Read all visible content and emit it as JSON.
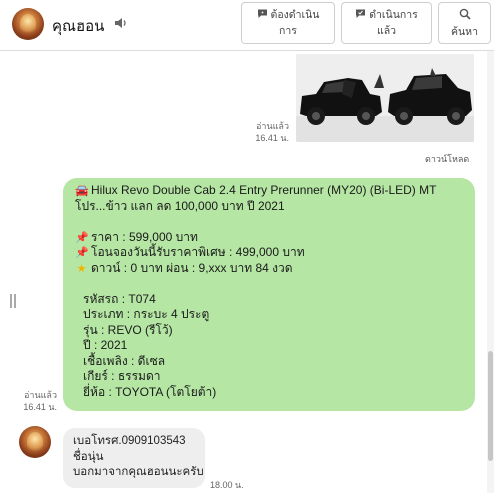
{
  "header": {
    "contact_name": "คุณฮอน",
    "follow_button": [
      "ต้องดำเนิน",
      "การ"
    ],
    "progress_button": [
      "ดำเนินการ",
      "แล้ว"
    ],
    "search_button": "ค้นหา"
  },
  "photo_message": {
    "read_label": "อ่านแล้ว",
    "time": "16.41 น.",
    "download_label": "ดาวน์โหลด"
  },
  "outgoing_message": {
    "lines": [
      {
        "icon": "car-emoji-icon",
        "text": "Hilux Revo Double Cab 2.4 Entry Prerunner (MY20) (Bi-LED) MT"
      },
      {
        "icon": "",
        "text": "โปร...ข้าว แลก ลด 100,000 บาท ปี 2021"
      },
      {
        "icon": "",
        "text": ""
      },
      {
        "icon": "pushpin-icon",
        "text": "ราคา : 599,000 บาท"
      },
      {
        "icon": "pushpin-icon",
        "text": "โอนจองวันนี้รับราคาพิเศษ : 499,000 บาท"
      },
      {
        "icon": "star-icon",
        "text": "ดาวน์ : 0 บาท ผ่อน : 9,xxx บาท 84 งวด"
      },
      {
        "icon": "",
        "text": ""
      },
      {
        "icon": "",
        "text": "รหัสรถ : T074"
      },
      {
        "icon": "",
        "text": "ประเภท : กระบะ 4 ประตู"
      },
      {
        "icon": "",
        "text": "รุ่น : REVO (รีโว้)"
      },
      {
        "icon": "",
        "text": "ปี : 2021"
      },
      {
        "icon": "",
        "text": "เชื้อเพลิง : ดีเซล"
      },
      {
        "icon": "",
        "text": "เกียร์ : ธรรมดา"
      },
      {
        "icon": "",
        "text": "ยี่ห้อ : TOYOTA (โตโยต้า)"
      }
    ],
    "read_label": "อ่านแล้ว",
    "time": "16.41 น."
  },
  "incoming_message": {
    "lines": [
      "เบอโทรศ.0909103543",
      "ชื่อนุ่น",
      "บอกมาจากคุณฮอนนะครับ"
    ],
    "time": "18.00 น."
  },
  "colors": {
    "outgoing_bubble": "#b5e6a4",
    "incoming_bubble": "#eeeeee",
    "truck": "#111111"
  }
}
